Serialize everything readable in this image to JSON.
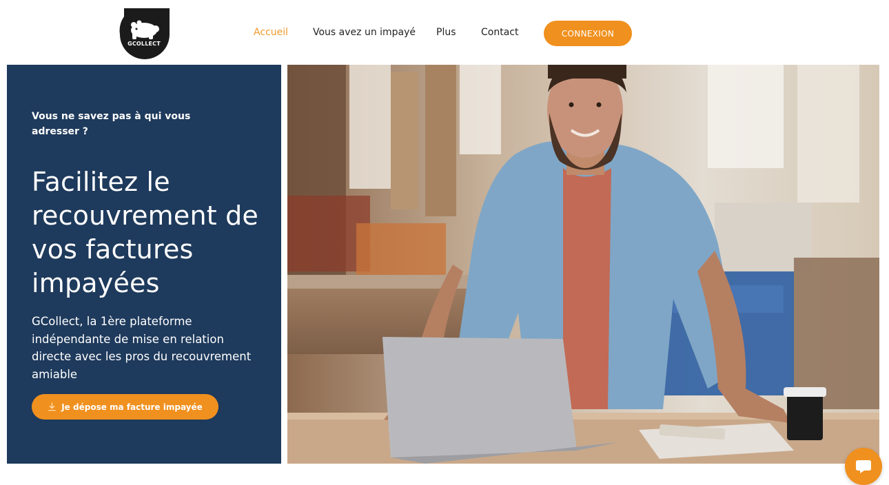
{
  "brand": {
    "logo_text": "GCOLLECT",
    "accent_color": "#f0901e",
    "panel_color": "#1e3a5c"
  },
  "nav": {
    "items": [
      {
        "label": "Accueil",
        "active": true
      },
      {
        "label": "Vous avez un impayé",
        "active": false
      },
      {
        "label": "Plus",
        "active": false
      },
      {
        "label": "Contact",
        "active": false
      }
    ],
    "login_label": "CONNEXION"
  },
  "hero": {
    "eyebrow": "Vous ne savez pas à qui vous adresser ?",
    "headline": "Facilitez le recouvrement de vos factures impayées",
    "description": "GCollect, la 1ère plateforme indépendante de mise en relation directe avec les pros du recouvrement amiable",
    "cta_label": "Je dépose ma facture impayée",
    "cta_icon": "download-icon"
  },
  "chat": {
    "icon": "chat-bubble-icon"
  }
}
